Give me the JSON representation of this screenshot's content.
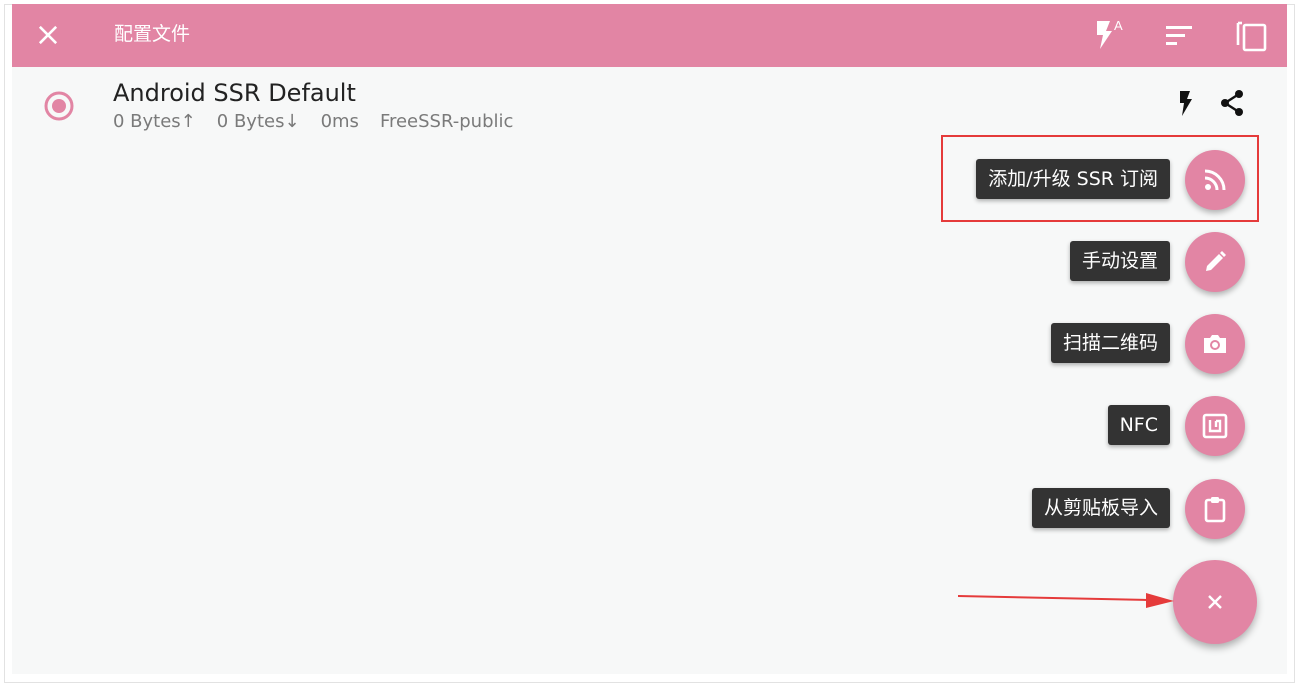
{
  "toolbar": {
    "title": "配置文件",
    "close_icon": "close-icon",
    "actions": [
      "flash-auto-icon",
      "sort-icon",
      "copy-icon"
    ]
  },
  "profile": {
    "name": "Android SSR Default",
    "upload": "0 Bytes↑",
    "download": "0 Bytes↓",
    "latency": "0ms",
    "group": "FreeSSR-public",
    "actions": [
      "flash-icon",
      "share-icon"
    ]
  },
  "fab_menu": {
    "items": [
      {
        "label": "添加/升级 SSR 订阅",
        "icon": "rss-icon"
      },
      {
        "label": "手动设置",
        "icon": "pencil-icon"
      },
      {
        "label": "扫描二维码",
        "icon": "camera-icon"
      },
      {
        "label": "NFC",
        "icon": "nfc-icon"
      },
      {
        "label": "从剪贴板导入",
        "icon": "clipboard-icon"
      }
    ],
    "main_icon": "close-icon"
  },
  "colors": {
    "accent": "#e285a4",
    "background": "#f7f8f8",
    "tooltip": "#333333",
    "annotation": "#e53b3b"
  }
}
